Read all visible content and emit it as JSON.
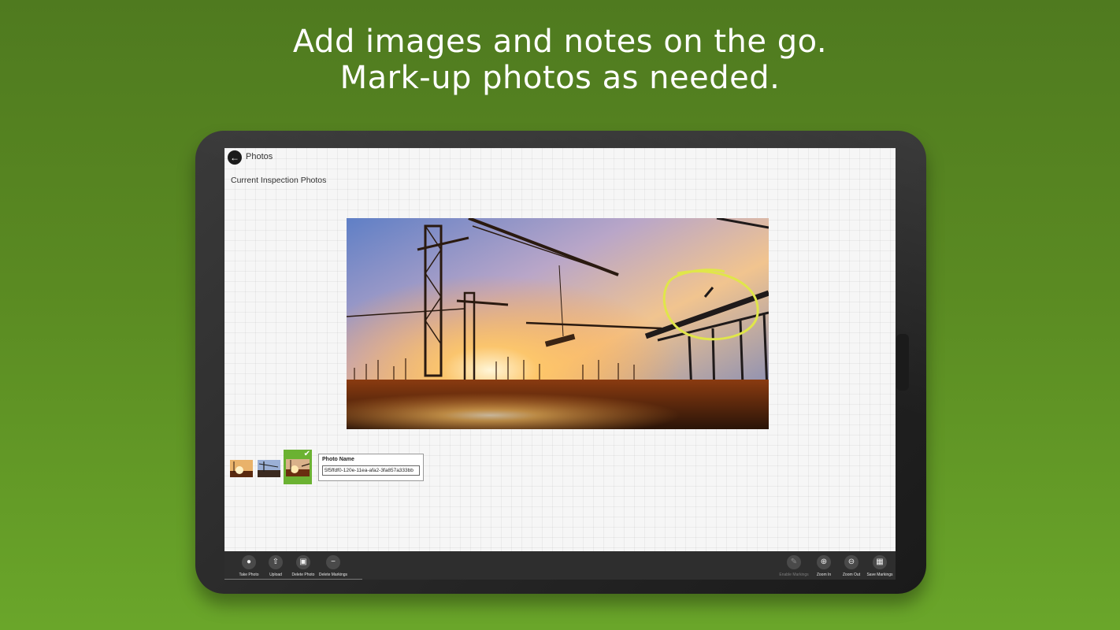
{
  "headline": {
    "line1": "Add images and notes on the go.",
    "line2": "Mark-up photos as needed."
  },
  "header": {
    "back_icon": "arrow-left-icon",
    "title": "Photos"
  },
  "section_label": "Current Inspection Photos",
  "photo": {
    "markup_circle_color": "#e0e64a"
  },
  "thumbnails": [
    {
      "selected": false
    },
    {
      "selected": false
    },
    {
      "selected": true,
      "badge_icon": "checkmark-icon"
    }
  ],
  "photo_name": {
    "label": "Photo Name",
    "value": "5f5ffdf0-120e-11ea-afa2-3fa857a333bb"
  },
  "appbar": {
    "left_buttons": [
      {
        "label": "Take Photo",
        "icon": "camera-icon"
      },
      {
        "label": "Upload",
        "icon": "upload-icon"
      },
      {
        "label": "Delete Photo",
        "icon": "trash-icon"
      },
      {
        "label": "Delete Markings",
        "icon": "minus-icon"
      }
    ],
    "right_buttons": [
      {
        "label": "Enable Markings",
        "icon": "brush-icon",
        "disabled": true
      },
      {
        "label": "Zoom In",
        "icon": "zoom-in-icon"
      },
      {
        "label": "Zoom Out",
        "icon": "zoom-out-icon"
      },
      {
        "label": "Save Markings",
        "icon": "save-icon"
      }
    ]
  },
  "colors": {
    "background": "#5a8a22",
    "accent_selected": "#6bb232",
    "appbar": "#2e2e2e"
  }
}
